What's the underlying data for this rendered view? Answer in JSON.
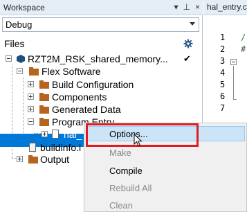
{
  "workspace": {
    "title": "Workspace",
    "title_buttons": [
      "▾",
      "⊥",
      "×"
    ],
    "config_value": "Debug",
    "files_label": "Files"
  },
  "tree": {
    "project": "RZT2M_RSK_shared_memory...",
    "project_check": "✔",
    "flex_software": "Flex Software",
    "build_configuration": "Build Configuration",
    "components": "Components",
    "generated_data": "Generated Data",
    "program_entry": "Program Entry",
    "hal_file": "hal_",
    "buildinfo": "buildinfo.i",
    "output": "Output"
  },
  "editor": {
    "tab_label": "hal_entry.c",
    "line_numbers": [
      "1",
      "2",
      "3",
      "4",
      "5",
      "6",
      "7"
    ],
    "code_fragments": [
      "/",
      "#"
    ]
  },
  "context_menu": {
    "items": [
      {
        "label": "Options...",
        "enabled": true
      },
      {
        "label": "Make",
        "enabled": false
      },
      {
        "label": "Compile",
        "enabled": true
      },
      {
        "label": "Rebuild All",
        "enabled": false
      },
      {
        "label": "Clean",
        "enabled": false
      }
    ]
  },
  "colors": {
    "selection": "#0078d7",
    "highlight_box": "#e01b24",
    "menu_hover": "#cce4f7"
  }
}
